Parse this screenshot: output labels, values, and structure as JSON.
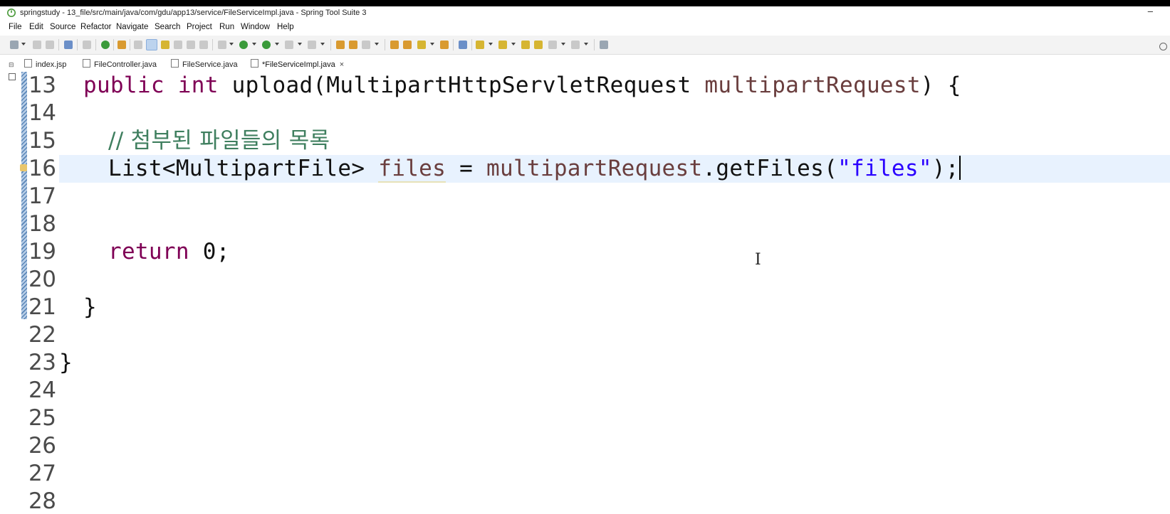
{
  "window": {
    "title": "springstudy - 13_file/src/main/java/com/gdu/app13/service/FileServiceImpl.java - Spring Tool Suite 3",
    "minimize": "–"
  },
  "menu": {
    "items": [
      "File",
      "Edit",
      "Source",
      "Refactor",
      "Navigate",
      "Search",
      "Project",
      "Run",
      "Window",
      "Help"
    ]
  },
  "tabs": [
    {
      "label": "index.jsp",
      "active": false
    },
    {
      "label": "FileController.java",
      "active": false
    },
    {
      "label": "FileService.java",
      "active": false
    },
    {
      "label": "*FileServiceImpl.java",
      "active": true,
      "close": "×"
    }
  ],
  "editor": {
    "current_line": 16,
    "lines": [
      {
        "num": "13",
        "text": "  public int upload(MultipartHttpServletRequest multipartRequest) {"
      },
      {
        "num": "14",
        "text": ""
      },
      {
        "num": "15",
        "text": "    // 첨부된 파일들의 목록"
      },
      {
        "num": "16",
        "text": "    List<MultipartFile> files = multipartRequest.getFiles(\"files\");"
      },
      {
        "num": "17",
        "text": ""
      },
      {
        "num": "18",
        "text": ""
      },
      {
        "num": "19",
        "text": "    return 0;"
      },
      {
        "num": "20",
        "text": ""
      },
      {
        "num": "21",
        "text": "  }"
      },
      {
        "num": "22",
        "text": ""
      },
      {
        "num": "23",
        "text": "}"
      },
      {
        "num": "24",
        "text": ""
      },
      {
        "num": "25",
        "text": ""
      },
      {
        "num": "26",
        "text": ""
      },
      {
        "num": "27",
        "text": ""
      },
      {
        "num": "28",
        "text": ""
      }
    ],
    "tokens": {
      "l13_kw1": "public",
      "l13_kw2": "int",
      "l13_method": "upload(MultipartHttpServletRequest",
      "l13_param": "multipartRequest",
      "l13_end": ") {",
      "l15_comment": "// 첨부된 파일들의 목록",
      "l16_type": "List<MultipartFile>",
      "l16_var": "files",
      "l16_eq": "=",
      "l16_obj": "multipartRequest",
      "l16_call": ".getFiles(",
      "l16_str": "\"files\"",
      "l16_end": ");",
      "l19_kw": "return",
      "l19_val": "0;",
      "l21_brace": "}",
      "l23_brace": "}"
    }
  },
  "colors": {
    "keyword": "#7f0055",
    "comment": "#3f7f5f",
    "string": "#2a00ff",
    "local_variable": "#6a3e3e",
    "current_line_bg": "#e8f2fe"
  },
  "icons": {
    "app": "spring-leaf-icon",
    "cursor": "i-beam-cursor-icon"
  }
}
